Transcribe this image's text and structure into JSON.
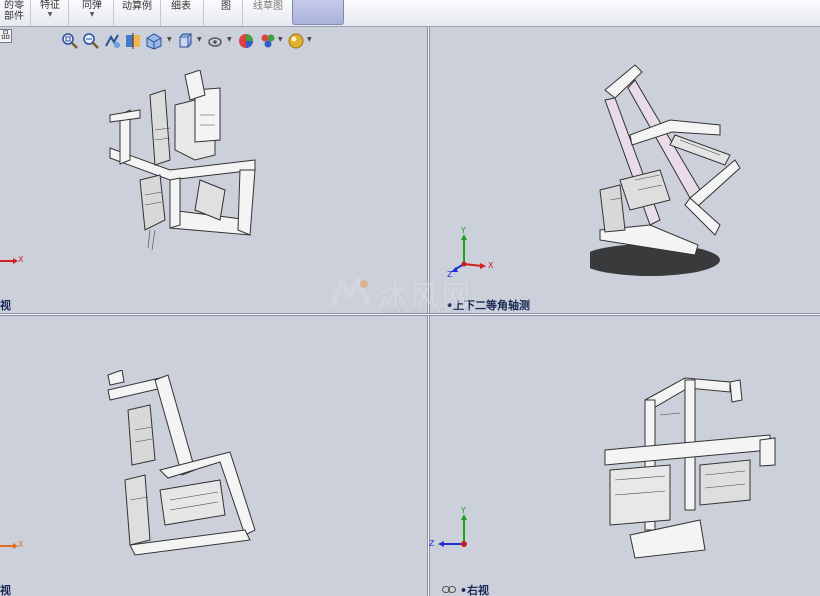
{
  "ribbon": {
    "items": [
      {
        "label": "的零\n部件"
      },
      {
        "label": "特征"
      },
      {
        "label": "同弹"
      },
      {
        "label": "动算例"
      },
      {
        "label": "细表"
      },
      {
        "label": "图"
      },
      {
        "label": "线草图"
      }
    ]
  },
  "left_tab": {
    "label": "品"
  },
  "viewports": {
    "top_left": {
      "label": "视",
      "axis_x": "X"
    },
    "top_right": {
      "label": "•上下二等角轴测",
      "axis_x": "X",
      "axis_y": "Y",
      "axis_z": "Z"
    },
    "bottom_left": {
      "label": "视",
      "axis_x": "X"
    },
    "bottom_right": {
      "label": "•右视",
      "axis_y": "Y",
      "axis_z": "Z"
    }
  },
  "hud": {
    "icons": [
      "zoom-to-fit-icon",
      "zoom-area-icon",
      "previous-view-icon",
      "section-view-icon",
      "view-orientation-icon",
      "display-style-icon",
      "hide-show-items-icon",
      "edit-appearance-icon",
      "apply-scene-icon",
      "view-settings-icon"
    ]
  },
  "watermark": {
    "text": "沐风网",
    "url": "www.mfcad.com"
  },
  "colors": {
    "x_axis": "#d22020",
    "y_axis": "#20a020",
    "z_axis": "#2030d0",
    "viewport_bg": "#cbd0da"
  }
}
